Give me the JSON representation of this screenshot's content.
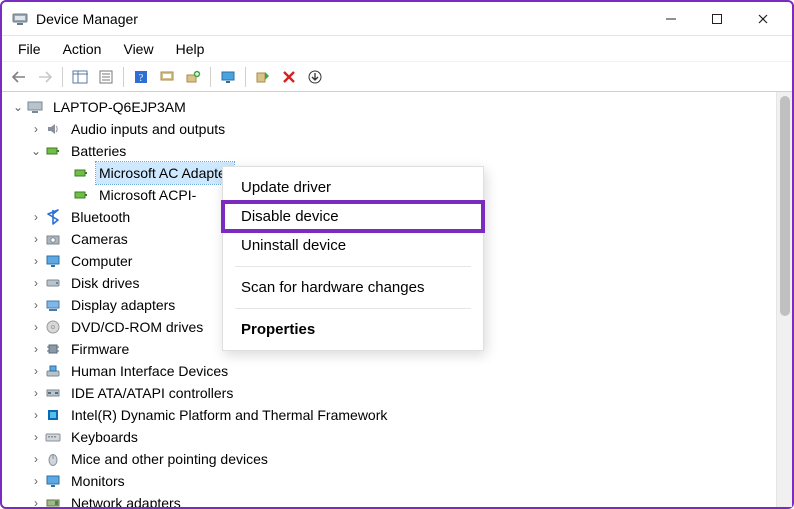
{
  "window": {
    "title": "Device Manager"
  },
  "menubar": {
    "file": "File",
    "action": "Action",
    "view": "View",
    "help": "Help"
  },
  "tree": {
    "root": "LAPTOP-Q6EJP3AM",
    "audio": "Audio inputs and outputs",
    "batteries": "Batteries",
    "bat_ac": "Microsoft AC Adapter",
    "bat_acpi": "Microsoft ACPI-",
    "bluetooth": "Bluetooth",
    "cameras": "Cameras",
    "computer": "Computer",
    "disk": "Disk drives",
    "display": "Display adapters",
    "dvd": "DVD/CD-ROM drives",
    "firmware": "Firmware",
    "hid": "Human Interface Devices",
    "ide": "IDE ATA/ATAPI controllers",
    "intel": "Intel(R) Dynamic Platform and Thermal Framework",
    "keyboards": "Keyboards",
    "mice": "Mice and other pointing devices",
    "monitors": "Monitors",
    "network": "Network adapters"
  },
  "context_menu": {
    "update": "Update driver",
    "disable": "Disable device",
    "uninstall": "Uninstall device",
    "scan": "Scan for hardware changes",
    "properties": "Properties"
  },
  "colors": {
    "accent": "#7b2cbf",
    "selection": "#cde8ff"
  }
}
